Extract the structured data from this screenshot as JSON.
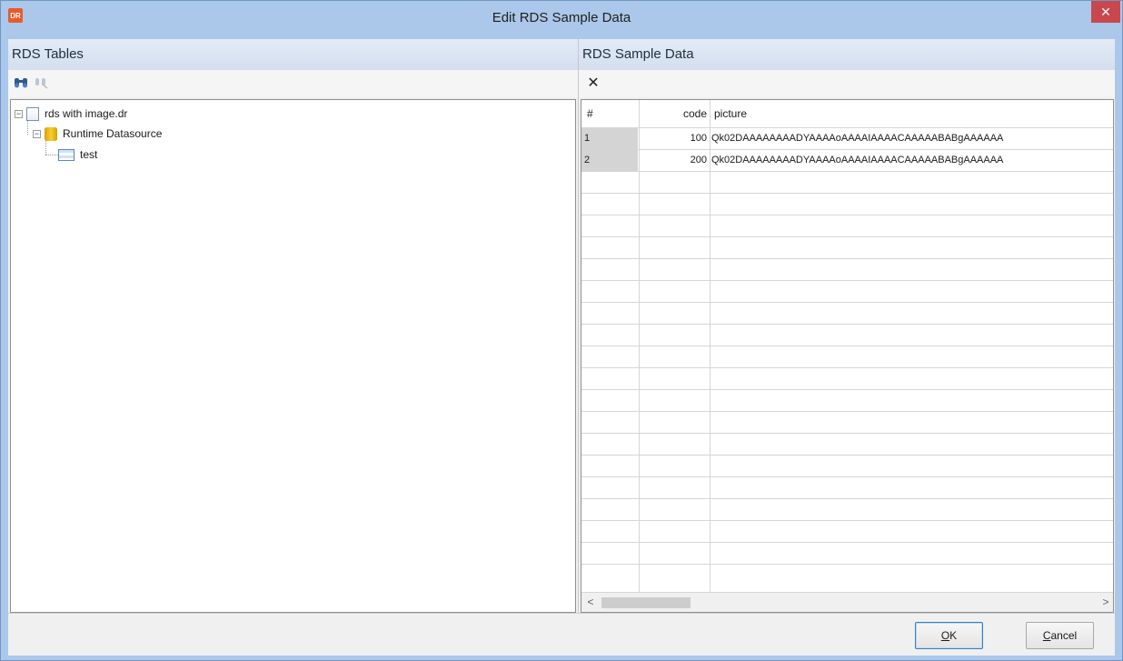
{
  "window": {
    "title": "Edit RDS Sample Data",
    "app_icon_text": "DR",
    "close_glyph": "✕"
  },
  "left_panel": {
    "header": "RDS Tables",
    "toolbar": {
      "find_icon": "binoculars-icon",
      "clear_icon": "clear-filter-icon"
    },
    "tree": [
      {
        "label": "rds with image.dr",
        "icon": "file-icon",
        "expander": "−"
      },
      {
        "label": "Runtime Datasource",
        "icon": "database-icon",
        "expander": "−"
      },
      {
        "label": "test",
        "icon": "table-icon"
      }
    ]
  },
  "right_panel": {
    "header": "RDS Sample Data",
    "toolbar": {
      "delete_icon": "delete-x-icon",
      "delete_glyph": "✕"
    },
    "grid": {
      "columns": [
        "#",
        "code",
        "picture"
      ],
      "rows": [
        {
          "num": "1",
          "code": "100",
          "picture": "Qk02DAAAAAAAADYAAAAoAAAAIAAAACAAAAABABgAAAAAA"
        },
        {
          "num": "2",
          "code": "200",
          "picture": "Qk02DAAAAAAAADYAAAAoAAAAIAAAACAAAAABABgAAAAAA"
        }
      ],
      "scroll_left": "<",
      "scroll_right": ">"
    }
  },
  "buttons": {
    "ok_mnemonic": "O",
    "ok_rest": "K",
    "cancel_mnemonic": "C",
    "cancel_rest": "ancel"
  }
}
